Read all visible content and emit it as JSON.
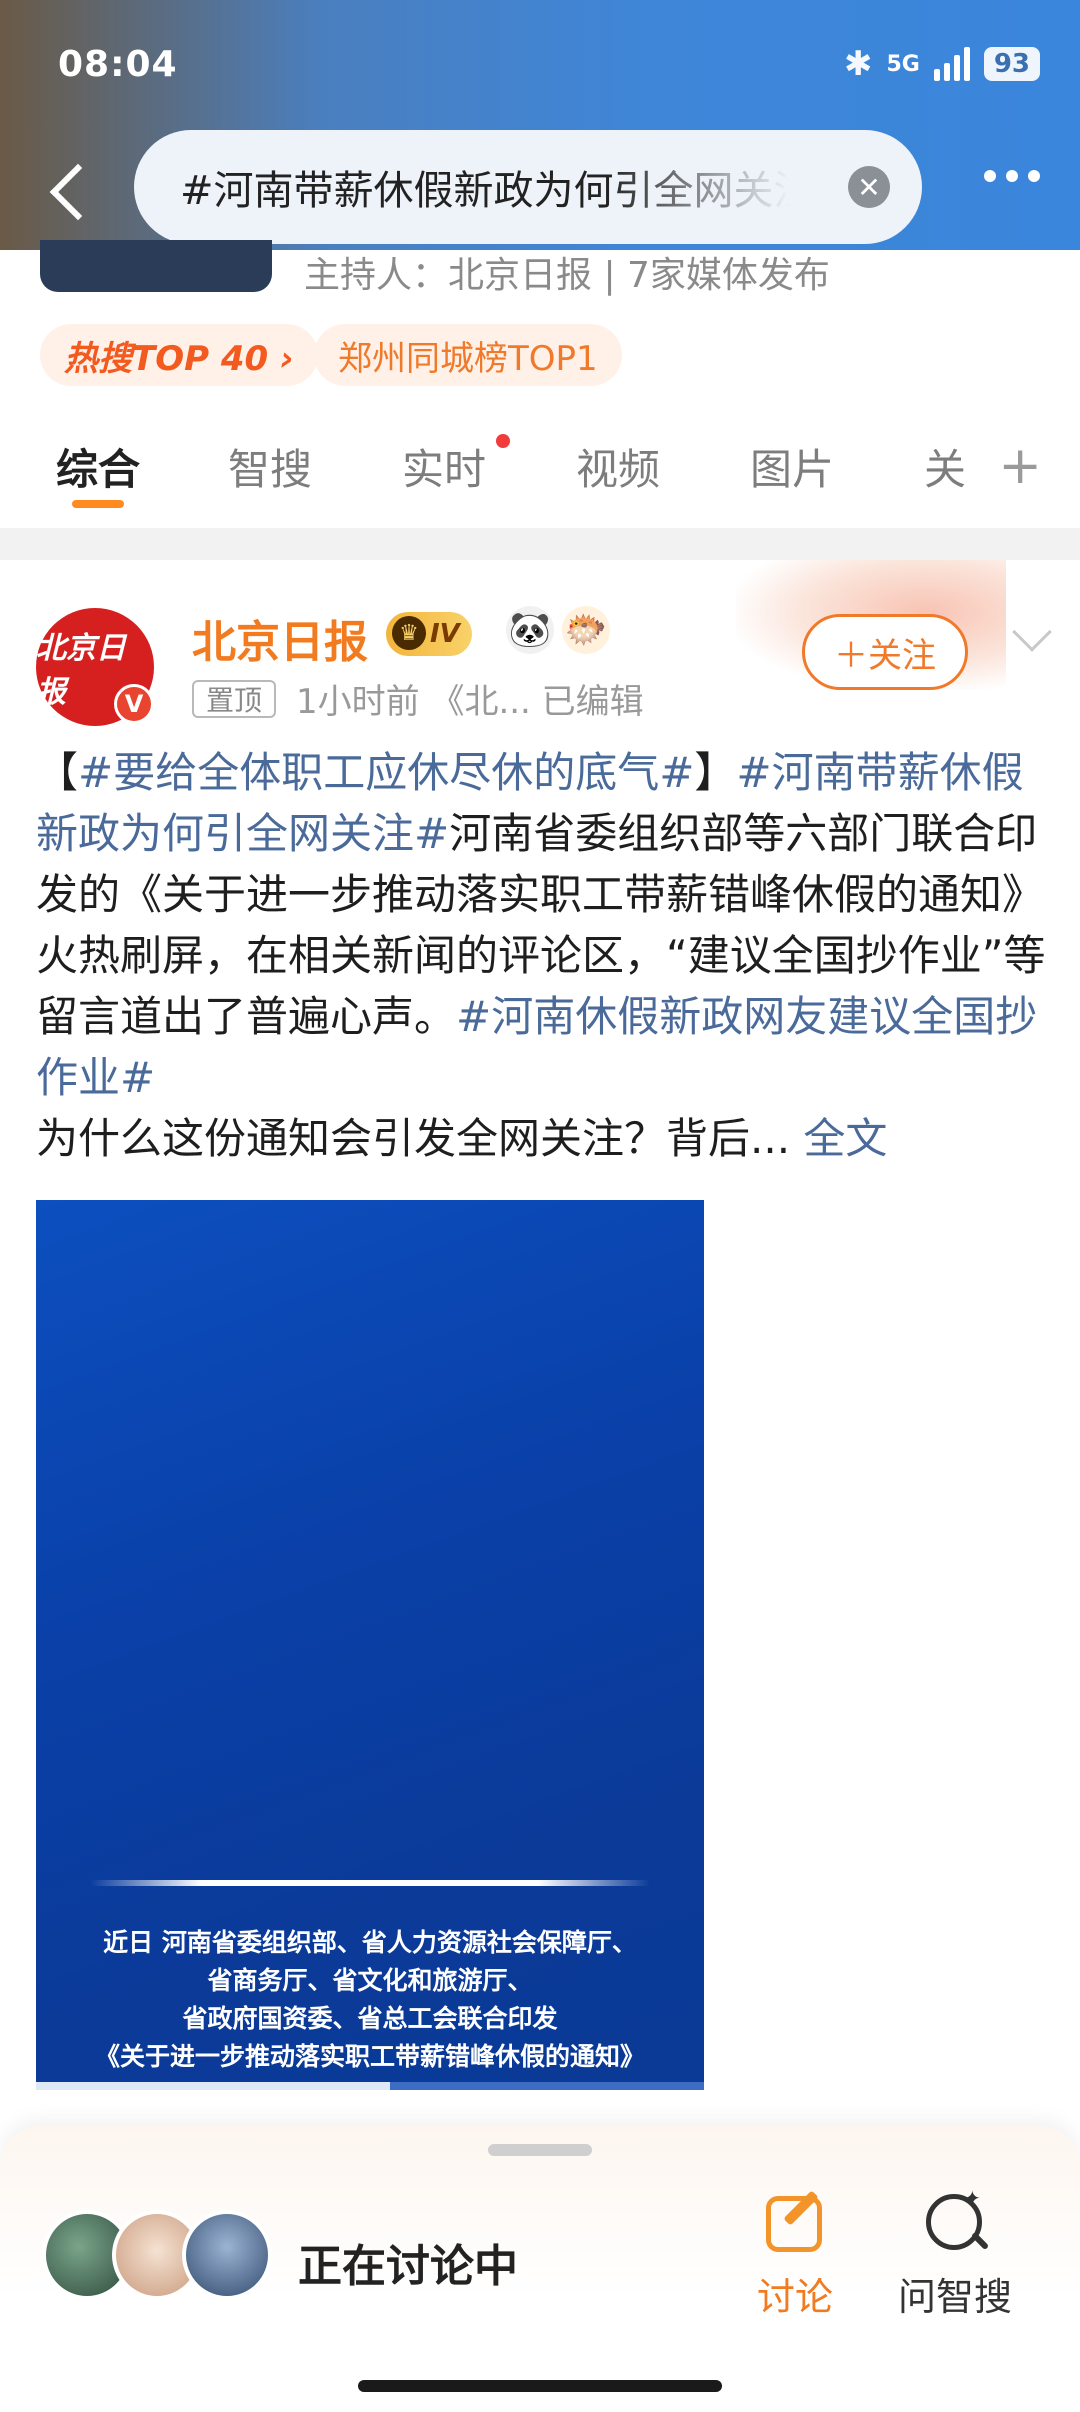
{
  "status_bar": {
    "time": "08:04",
    "network": "5G",
    "battery": "93",
    "bluetooth_icon": "bluetooth-icon"
  },
  "search": {
    "query": "#河南带薪休假新政为何引全网关注#"
  },
  "topic": {
    "host": "主持人：北京日报 | 7家媒体发布",
    "hot_tag": "热搜TOP 40 ›",
    "city_tag": "郑州同城榜TOP1"
  },
  "tabs": [
    {
      "label": "综合",
      "active": true
    },
    {
      "label": "智搜",
      "active": false
    },
    {
      "label": "实时",
      "active": false,
      "dot": true
    },
    {
      "label": "视频",
      "active": false
    },
    {
      "label": "图片",
      "active": false
    },
    {
      "label": "关",
      "active": false
    }
  ],
  "post": {
    "author": "北京日报",
    "avatar_text": "北京日报",
    "level": "IV",
    "pin_label": "置顶",
    "meta": "1小时前  《北...  已编辑",
    "follow_label": "＋关注",
    "text_parts": [
      {
        "t": "【",
        "tag": false
      },
      {
        "t": "#要给全体职工应休尽休的底气#",
        "tag": true
      },
      {
        "t": "】",
        "tag": false
      },
      {
        "t": "#河南带薪休假新政为何引全网关注#",
        "tag": true
      },
      {
        "t": "河南省委组织部等六部门联合印发的《关于进一步推动落实职工带薪错峰休假的通知》火热刷屏，在相关新闻的评论区，“建议全国抄作业”等留言道出了普遍心声。",
        "tag": false
      },
      {
        "t": "#河南休假新政网友建议全国抄作业#",
        "tag": true
      }
    ],
    "text_tail": "为什么这份通知会引发全网关注？背后...",
    "full_text_label": "全文",
    "image_caption": [
      "近日 河南省委组织部、省人力资源社会保障厅、",
      "省商务厅、省文化和旅游厅、",
      "省政府国资委、省总工会联合印发",
      "《关于进一步推动落实职工带薪错峰休假的通知》"
    ],
    "image_progress": 0.53
  },
  "bottom_bar": {
    "discussing": "正在讨论中",
    "discuss_label": "讨论",
    "ask_label": "问智搜"
  },
  "colors": {
    "accent": "#f27a1f",
    "hashtag": "#4a6a9a",
    "header": "#3f86d8"
  }
}
